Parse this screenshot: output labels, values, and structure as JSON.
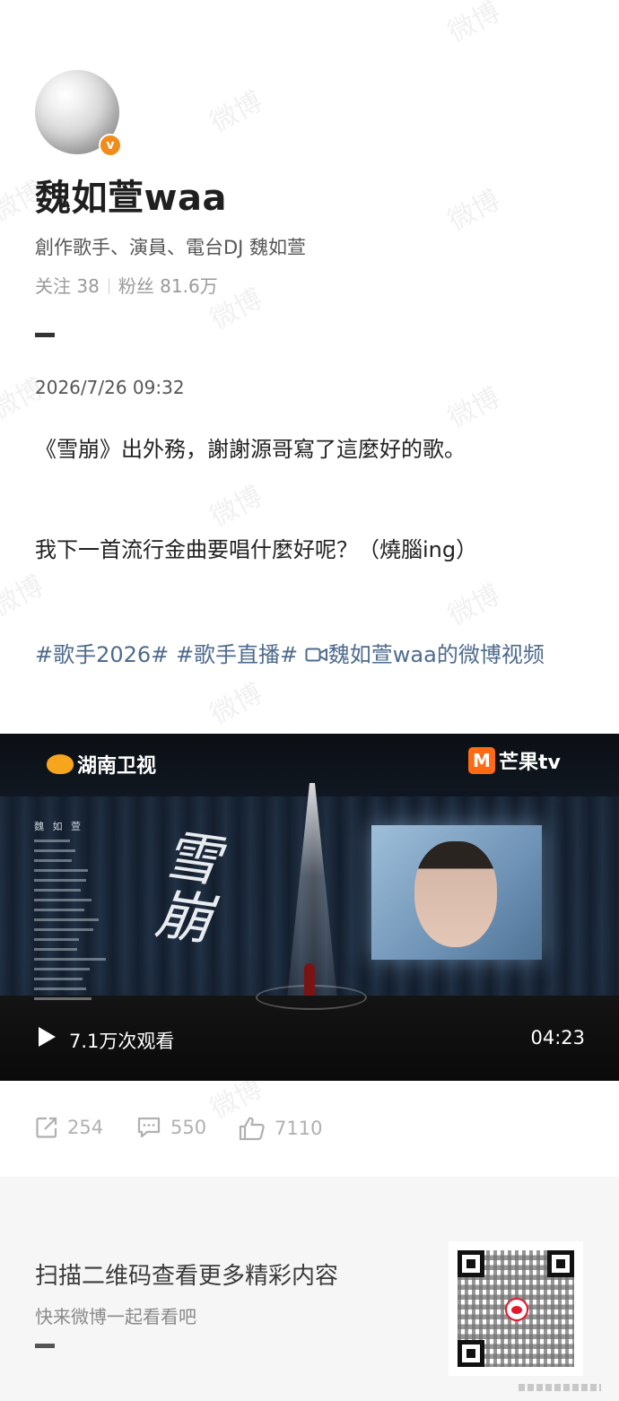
{
  "watermark": {
    "text": "微博"
  },
  "profile": {
    "name": "魏如萱waa",
    "bio": "創作歌手、演員、電台DJ 魏如萱",
    "following_label": "关注",
    "following_count": "38",
    "followers_label": "粉丝",
    "followers_count": "81.6万",
    "verified_badge": "v"
  },
  "post": {
    "timestamp": "2026/7/26 09:32",
    "line1": "《雪崩》出外務，謝謝源哥寫了這麼好的歌。",
    "line2": "我下一首流行金曲要唱什麼好呢？（燒腦ing）",
    "hashtag1": "#歌手2026#",
    "hashtag2": "#歌手直播#",
    "video_link": "魏如萱waa的微博视频"
  },
  "video": {
    "channel_logo_left": "湖南卫视",
    "channel_logo_right": "芒果tv",
    "channel_logo_right_mark": "M",
    "credit_title": "魏 如 萱",
    "song_title": "雪崩",
    "views": "7.1万次观看",
    "duration": "04:23"
  },
  "actions": {
    "repost_count": "254",
    "comment_count": "550",
    "like_count": "7110"
  },
  "footer": {
    "title": "扫描二维码查看更多精彩内容",
    "subtitle": "快来微博一起看看吧"
  },
  "colors": {
    "link": "#4e6b8e",
    "badge": "#f08c1a",
    "weibo_red": "#e6162d"
  }
}
